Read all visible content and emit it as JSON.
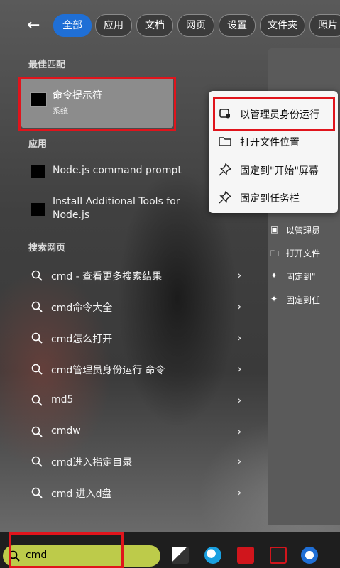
{
  "header": {
    "back_icon": "arrow-left-icon",
    "tabs": [
      {
        "label": "全部",
        "active": true
      },
      {
        "label": "应用",
        "active": false
      },
      {
        "label": "文档",
        "active": false
      },
      {
        "label": "网页",
        "active": false
      },
      {
        "label": "设置",
        "active": false
      },
      {
        "label": "文件夹",
        "active": false
      },
      {
        "label": "照片",
        "active": false
      }
    ]
  },
  "best_match": {
    "section_title": "最佳匹配",
    "title": "命令提示符",
    "subtitle": "系统"
  },
  "apps": {
    "section_title": "应用",
    "items": [
      {
        "label": "Node.js command prompt"
      },
      {
        "label": "Install Additional Tools for Node.js"
      }
    ]
  },
  "web": {
    "section_title": "搜索网页",
    "items": [
      {
        "label": "cmd - 查看更多搜索结果"
      },
      {
        "label": "cmd命令大全"
      },
      {
        "label": "cmd怎么打开"
      },
      {
        "label": "cmd管理员身份运行 命令"
      },
      {
        "label": "md5"
      },
      {
        "label": "cmdw"
      },
      {
        "label": "cmd进入指定目录"
      },
      {
        "label": "cmd 进入d盘"
      }
    ]
  },
  "context_menu": {
    "items": [
      {
        "label": "以管理员身份运行",
        "icon": "shield-admin-icon"
      },
      {
        "label": "打开文件位置",
        "icon": "folder-icon"
      },
      {
        "label": "固定到\"开始\"屏幕",
        "icon": "pin-icon"
      },
      {
        "label": "固定到任务栏",
        "icon": "pin-icon"
      }
    ]
  },
  "right_panel": {
    "items": [
      {
        "label": "以管理员",
        "icon": "shield-admin-icon"
      },
      {
        "label": "打开文件",
        "icon": "folder-icon"
      },
      {
        "label": "固定到\"",
        "icon": "pin-icon"
      },
      {
        "label": "固定到任",
        "icon": "pin-icon"
      }
    ]
  },
  "taskbar": {
    "search_value": "cmd",
    "search_icon": "search-icon"
  },
  "colors": {
    "highlight_red": "#e0141c",
    "active_tab": "#1f6fd6",
    "search_box": "#bdcb4a"
  }
}
